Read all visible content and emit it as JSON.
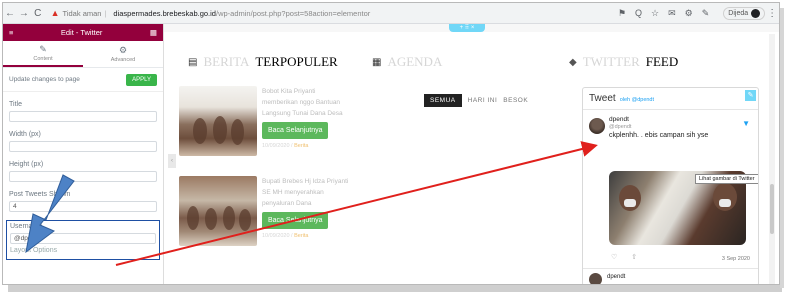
{
  "browser": {
    "back": "←",
    "forward": "→",
    "reload": "C",
    "warning_icon": "▲",
    "security_text": "Tidak aman",
    "host": "diaspermades.brebeskab.go.id",
    "path": "/wp-admin/post.php?post=58action=elementor",
    "icons": [
      "⚑",
      "Q",
      "☆",
      "✉",
      "⚙",
      "✎"
    ],
    "profile_label": "Dijeda"
  },
  "panel": {
    "title": "Edit - Twitter",
    "tabs": [
      {
        "icon": "✎",
        "label": "Content"
      },
      {
        "icon": "⚙",
        "label": "Advanced"
      }
    ],
    "update_text": "Update changes to page",
    "apply_label": "APPLY",
    "fields": [
      {
        "label": "Title",
        "value": ""
      },
      {
        "label": "Width (px)",
        "value": ""
      },
      {
        "label": "Height (px)",
        "value": ""
      },
      {
        "label": "Post Tweets Shown",
        "value": "4"
      },
      {
        "label": "Username",
        "value": "@dpendt"
      },
      {
        "label": "Layout Options",
        "value": ""
      }
    ]
  },
  "canvas": {
    "edit_handle": "+ ⠿ ×",
    "side_handle": "‹",
    "berita_faded": "BERITA",
    "berita_title": "TERPOPULER",
    "agenda_title": "AGENDA",
    "twitter_faded": "TWITTER",
    "twitter_title": "FEED",
    "agenda_tabs": [
      "SEMUA",
      "HARI INI",
      "BESOK"
    ],
    "news": [
      {
        "title": "Bobot Kita Priyanti memberikan nggo Bantuan Langsung Tunai Dana Desa",
        "button": "Baca Selanjutnya",
        "date": "10/09/2020 /",
        "tag": "Berita"
      },
      {
        "title": "Bupati Brebes Hj Idza Priyanti SE MH menyerahkan penyaluran Dana",
        "button": "Baca Selanjutnya",
        "date": "10/09/2020 /",
        "tag": "Berita"
      }
    ]
  },
  "twitter": {
    "heading": "Tweet",
    "by": "oleh @dpendt",
    "name": "dpendt",
    "handle": "@dpendt",
    "body": "ckplenhh. . ebis campan sih yse",
    "tooltip": "Lihat gambar di Twitter",
    "actions": [
      "♡",
      "⇧"
    ],
    "date": "3 Sep 2020",
    "next_name": "dpendt",
    "bird": "🐦"
  }
}
